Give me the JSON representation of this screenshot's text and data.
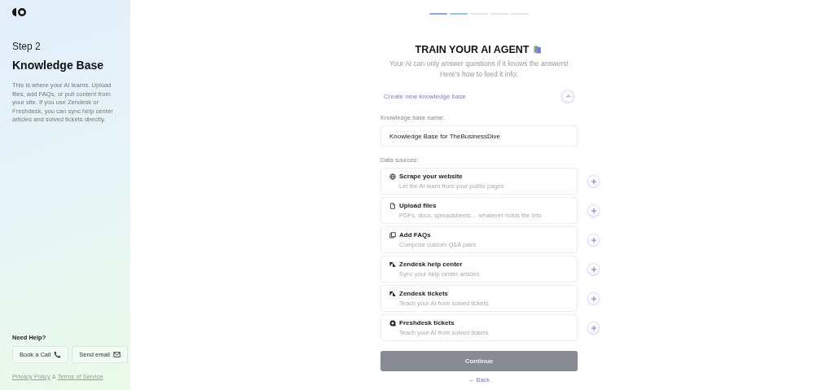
{
  "sidebar": {
    "step": "Step 2",
    "title": "Knowledge Base",
    "description": "This is where your AI learns. Upload files, add FAQs, or pull content from your site. If you use Zendesk or Freshdesk, you can sync help center articles and solved tickets directly.",
    "help_title": "Need Help?",
    "help_buttons": [
      {
        "label": "Book a Call",
        "kind": "phone"
      },
      {
        "label": "Send email",
        "kind": "mail"
      }
    ],
    "links": [
      "Privacy Policy",
      "&",
      "Terms of Service"
    ]
  },
  "progress": [
    {
      "done": true
    },
    {
      "done": true
    },
    {
      "done": false
    },
    {
      "done": false
    },
    {
      "done": false
    }
  ],
  "title": "TRAIN YOUR AI AGENT",
  "subtitle": "Your AI can only answer questions if it knows the answers! Here’s how to feed it info:",
  "section": {
    "label": "Create new knowledge base",
    "expanded": true
  },
  "name_field": {
    "label": "Knowledge base name:",
    "value": "Knowledge Base for TheBusinessDive"
  },
  "sources_label": "Data sources:",
  "sources": [
    {
      "kind": "globe",
      "title": "Scrape your website",
      "description": "Let the AI learn from your public pages"
    },
    {
      "kind": "file",
      "title": "Upload files",
      "description": "PDFs, docs, spreadsheets… whatever holds the info"
    },
    {
      "kind": "cards",
      "title": "Add FAQs",
      "description": "Compose custom Q&A pairs"
    },
    {
      "kind": "zendesk",
      "title": "Zendesk help center",
      "description": "Sync your help center articles"
    },
    {
      "kind": "zendesk",
      "title": "Zendesk tickets",
      "description": "Teach your AI from solved tickets"
    },
    {
      "kind": "freshdesk",
      "title": "Freshdesk tickets",
      "description": "Teach your AI from solved tickets"
    }
  ],
  "continue_button": "Continue",
  "back_link": "← Back"
}
